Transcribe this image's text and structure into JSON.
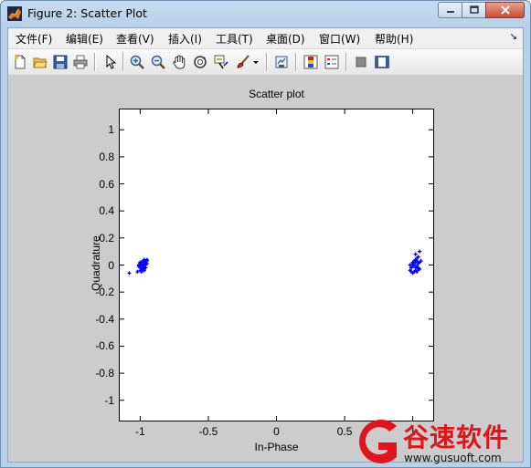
{
  "window": {
    "title": "Figure 2: Scatter Plot",
    "icon": "matlab-figure-icon"
  },
  "menubar": {
    "items": [
      "文件(F)",
      "编辑(E)",
      "查看(V)",
      "插入(I)",
      "工具(T)",
      "桌面(D)",
      "窗口(W)",
      "帮助(H)"
    ]
  },
  "toolbar": {
    "buttons": [
      "new-figure-icon",
      "open-file-icon",
      "save-figure-icon",
      "print-figure-icon",
      "edit-plot-icon",
      "zoom-in-icon",
      "zoom-out-icon",
      "pan-icon",
      "rotate-3d-icon",
      "data-cursor-icon",
      "brush-icon",
      "link-plot-icon",
      "insert-colorbar-icon",
      "insert-legend-icon",
      "hide-plot-tools-icon",
      "show-plot-tools-icon"
    ]
  },
  "chart_data": {
    "type": "scatter",
    "title": "Scatter plot",
    "xlabel": "In-Phase",
    "ylabel": "Quadrature",
    "xlim": [
      -1.15,
      1.15
    ],
    "ylim": [
      -1.15,
      1.15
    ],
    "xticks": [
      -1,
      -0.5,
      0,
      0.5,
      1
    ],
    "xtick_labels": [
      "-1",
      "-0.5",
      "0",
      "0.5",
      "1"
    ],
    "yticks": [
      1,
      0.8,
      0.6,
      0.4,
      0.2,
      0,
      -0.2,
      -0.4,
      -0.6,
      -0.8,
      -1
    ],
    "ytick_labels": [
      "1",
      "0.8",
      "0.6",
      "0.4",
      "0.2",
      "0",
      "-0.2",
      "-0.4",
      "-0.6",
      "-0.8",
      "-1"
    ],
    "grid": false,
    "marker_color": "#0000ff",
    "series": [
      {
        "x": [
          -1.08,
          -1.02,
          -1.0,
          -0.99,
          -0.98,
          -0.97,
          -0.96,
          -1.01,
          -1.0,
          -0.98,
          -0.97,
          -0.96,
          -0.95,
          -1.0,
          -0.99,
          -0.98,
          -0.96,
          -0.95,
          -1.01,
          -0.99,
          -0.97,
          -0.96,
          -1.0,
          -0.98,
          -0.97,
          -0.95,
          -0.99,
          -0.97
        ],
        "y": [
          -0.06,
          -0.05,
          -0.04,
          -0.05,
          -0.03,
          -0.04,
          -0.02,
          -0.01,
          -0.02,
          -0.01,
          -0.02,
          0.0,
          0.01,
          0.01,
          0.02,
          0.0,
          0.02,
          0.03,
          0.0,
          -0.03,
          0.01,
          0.03,
          0.02,
          0.03,
          0.04,
          0.04,
          0.0,
          0.02
        ]
      },
      {
        "x": [
          0.98,
          0.99,
          1.0,
          1.01,
          1.02,
          1.03,
          1.04,
          0.99,
          1.0,
          1.02,
          1.03,
          1.04,
          1.05,
          0.98,
          1.0,
          1.01,
          1.02,
          1.04,
          1.05,
          1.06,
          1.01,
          1.02,
          1.03,
          1.04,
          1.0,
          1.03,
          1.05,
          1.02
        ],
        "y": [
          -0.04,
          -0.05,
          -0.06,
          -0.05,
          -0.04,
          -0.05,
          -0.03,
          -0.02,
          -0.01,
          -0.02,
          -0.01,
          -0.02,
          -0.03,
          0.0,
          0.01,
          0.0,
          0.02,
          0.01,
          0.02,
          0.03,
          0.03,
          0.04,
          0.05,
          0.06,
          0.02,
          0.03,
          0.1,
          0.08
        ]
      }
    ]
  },
  "watermark": {
    "text": "谷速软件",
    "url": "www.gusuoft.com"
  }
}
